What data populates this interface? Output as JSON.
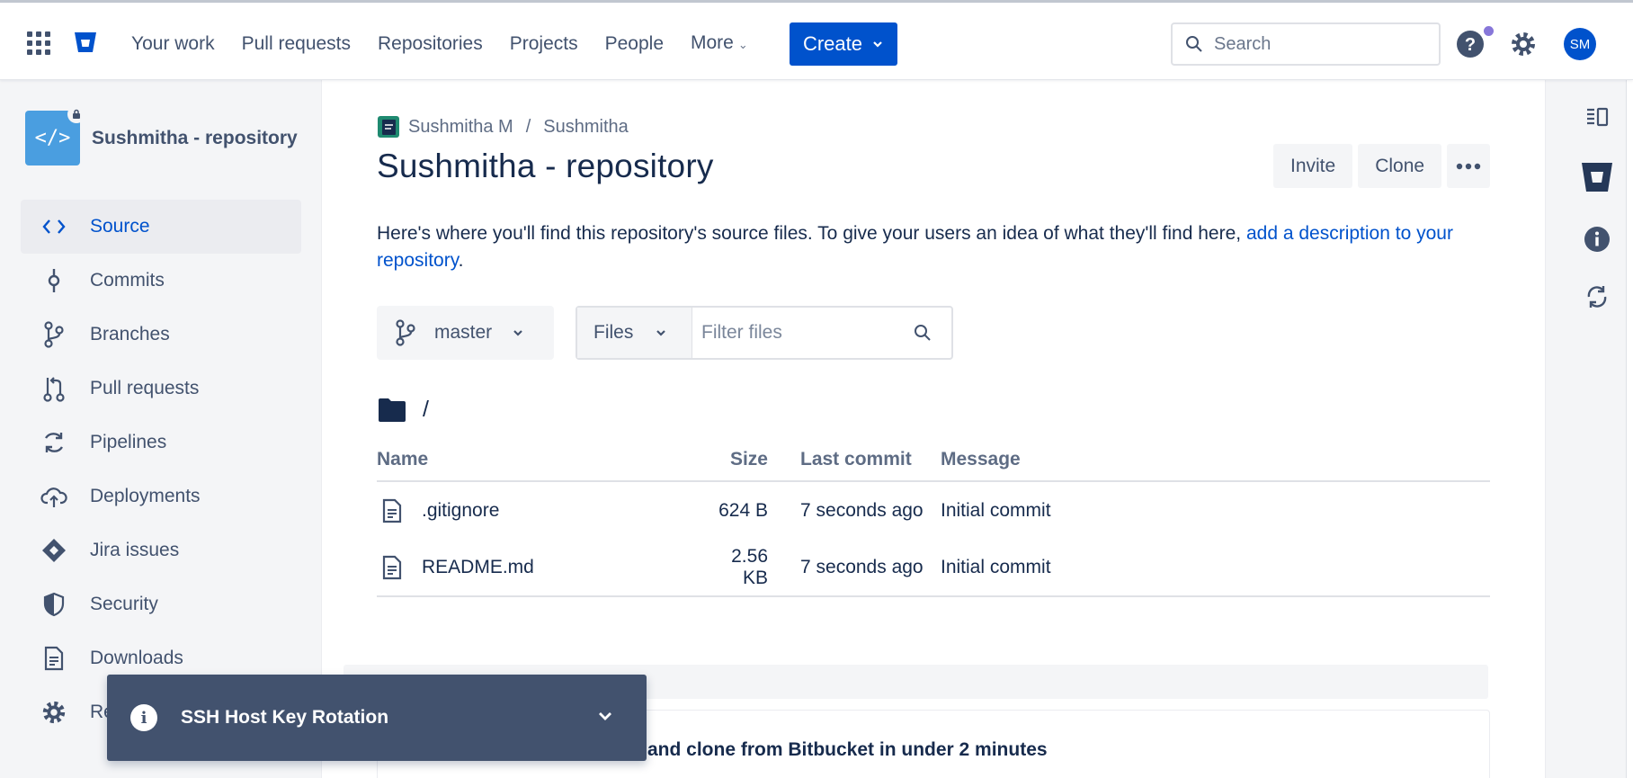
{
  "topbar": {
    "nav": [
      "Your work",
      "Pull requests",
      "Repositories",
      "Projects",
      "People",
      "More"
    ],
    "create_label": "Create",
    "search_placeholder": "Search",
    "avatar_initials": "SM"
  },
  "sidebar": {
    "repo_name": "Sushmitha - repository",
    "items": [
      {
        "label": "Source",
        "icon": "code-icon"
      },
      {
        "label": "Commits",
        "icon": "commit-icon"
      },
      {
        "label": "Branches",
        "icon": "branch-icon"
      },
      {
        "label": "Pull requests",
        "icon": "pull-request-icon"
      },
      {
        "label": "Pipelines",
        "icon": "pipelines-icon"
      },
      {
        "label": "Deployments",
        "icon": "cloud-upload-icon"
      },
      {
        "label": "Jira issues",
        "icon": "jira-icon"
      },
      {
        "label": "Security",
        "icon": "shield-icon"
      },
      {
        "label": "Downloads",
        "icon": "document-icon"
      },
      {
        "label": "Re",
        "icon": "gear-icon"
      }
    ]
  },
  "main": {
    "breadcrumb": [
      "Sushmitha M",
      "Sushmitha"
    ],
    "title": "Sushmitha - repository",
    "actions": {
      "invite": "Invite",
      "clone": "Clone"
    },
    "description_text": "Here's where you'll find this repository's source files. To give your users an idea of what they'll find here, ",
    "description_link": "add a description to your repository",
    "description_end": ".",
    "branch": "master",
    "files_dropdown": "Files",
    "filter_placeholder": "Filter files",
    "path": "/",
    "table": {
      "headers": [
        "Name",
        "Size",
        "Last commit",
        "Message"
      ],
      "rows": [
        {
          "name": ".gitignore",
          "size": "624 B",
          "last_commit": "7 seconds ago",
          "message": "Initial commit"
        },
        {
          "name": "README.md",
          "size": "2.56 KB",
          "last_commit": "7 seconds ago",
          "message": "Initial commit"
        }
      ]
    },
    "promo_title": "and clone from Bitbucket in under 2 minutes"
  },
  "toast": {
    "title": "SSH Host Key Rotation"
  },
  "colors": {
    "primary": "#0052cc",
    "text": "#172b4d",
    "subtle": "#42526e",
    "sidebar_bg": "#f4f5f7",
    "toast_bg": "#42526e"
  }
}
